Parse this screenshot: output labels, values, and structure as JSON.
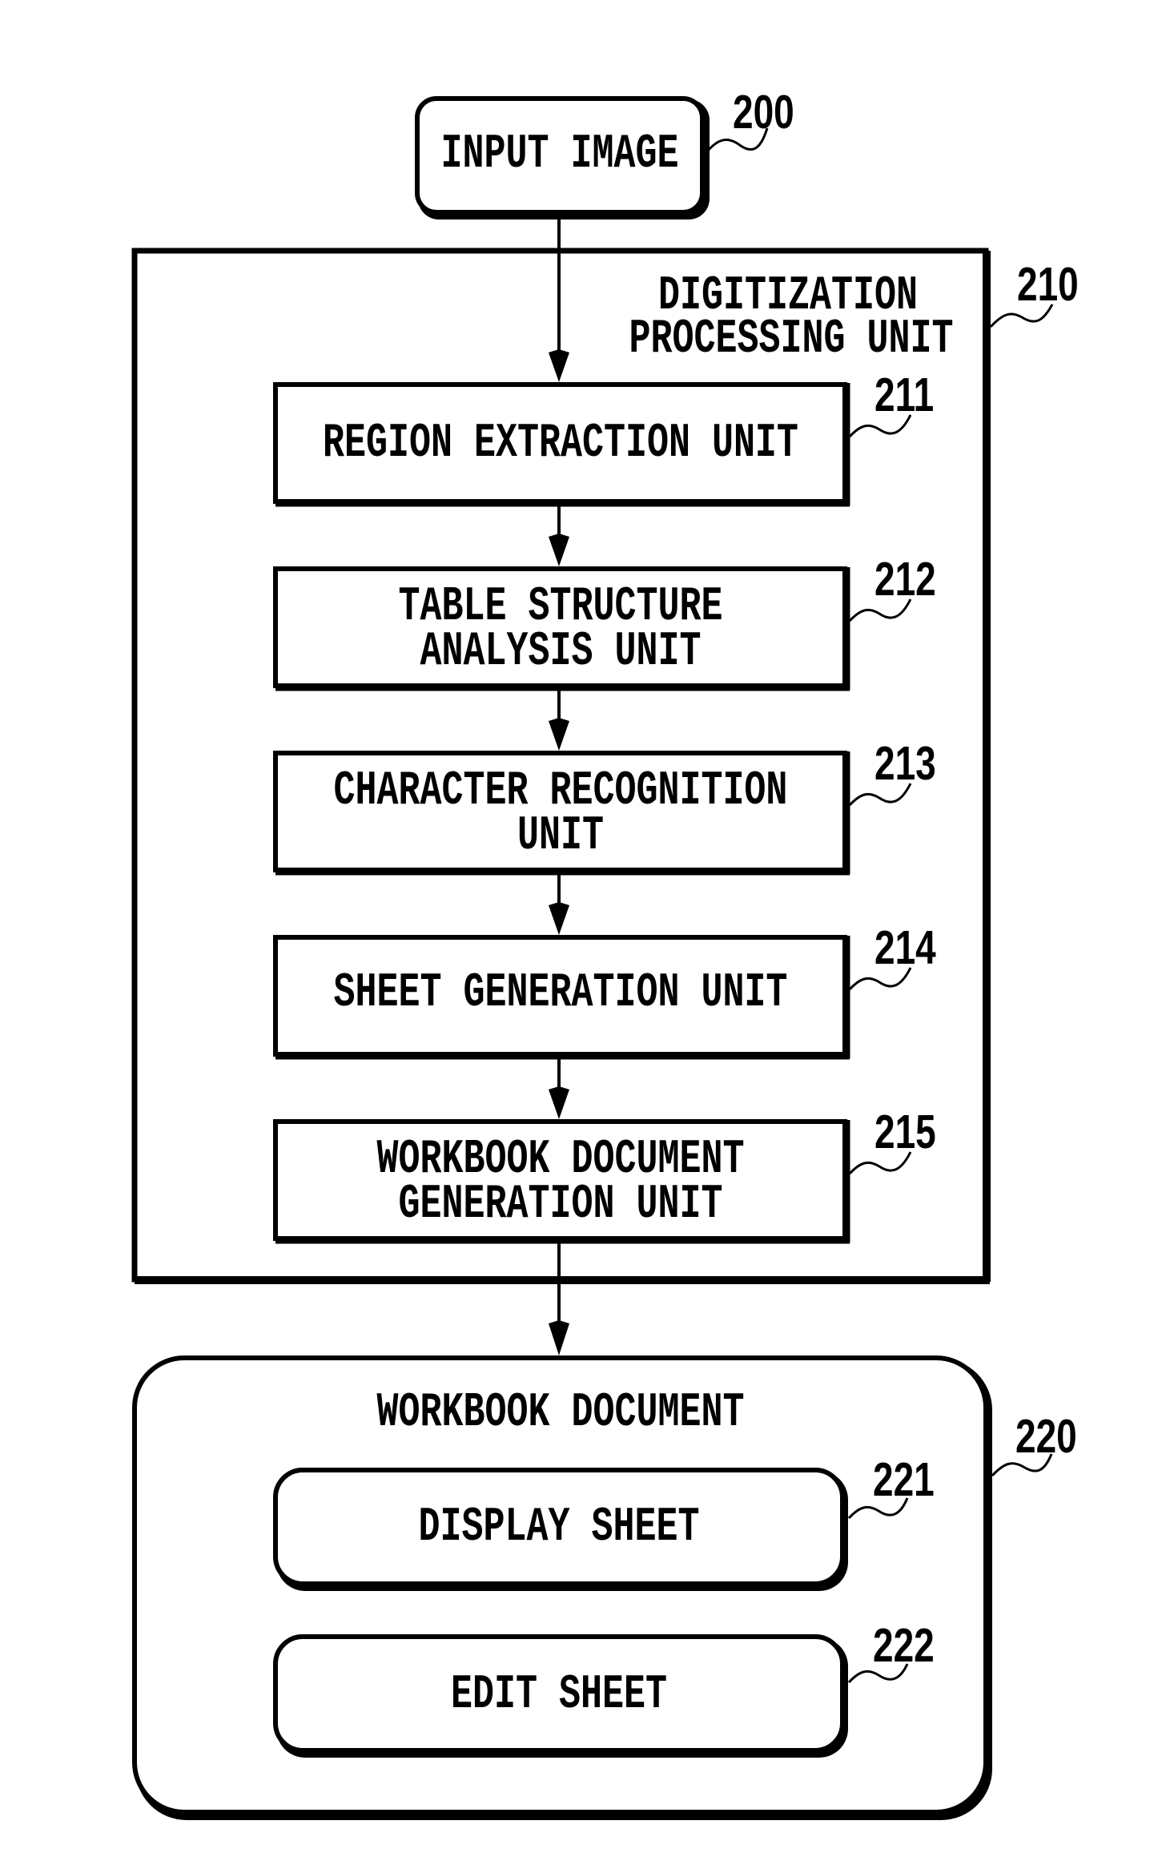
{
  "figure": {
    "input_image": {
      "ref": "200",
      "lines": [
        "INPUT IMAGE"
      ]
    },
    "digitization_unit": {
      "ref": "210",
      "title_lines": [
        "DIGITIZATION",
        "PROCESSING UNIT"
      ],
      "units": [
        {
          "ref": "211",
          "lines": [
            "REGION EXTRACTION UNIT"
          ]
        },
        {
          "ref": "212",
          "lines": [
            "TABLE STRUCTURE",
            "ANALYSIS UNIT"
          ]
        },
        {
          "ref": "213",
          "lines": [
            "CHARACTER RECOGNITION",
            "UNIT"
          ]
        },
        {
          "ref": "214",
          "lines": [
            "SHEET GENERATION UNIT"
          ]
        },
        {
          "ref": "215",
          "lines": [
            "WORKBOOK DOCUMENT",
            "GENERATION UNIT"
          ]
        }
      ]
    },
    "workbook_document": {
      "ref": "220",
      "title_lines": [
        "WORKBOOK DOCUMENT"
      ],
      "sheets": [
        {
          "ref": "221",
          "lines": [
            "DISPLAY SHEET"
          ]
        },
        {
          "ref": "222",
          "lines": [
            "EDIT SHEET"
          ]
        }
      ]
    }
  }
}
